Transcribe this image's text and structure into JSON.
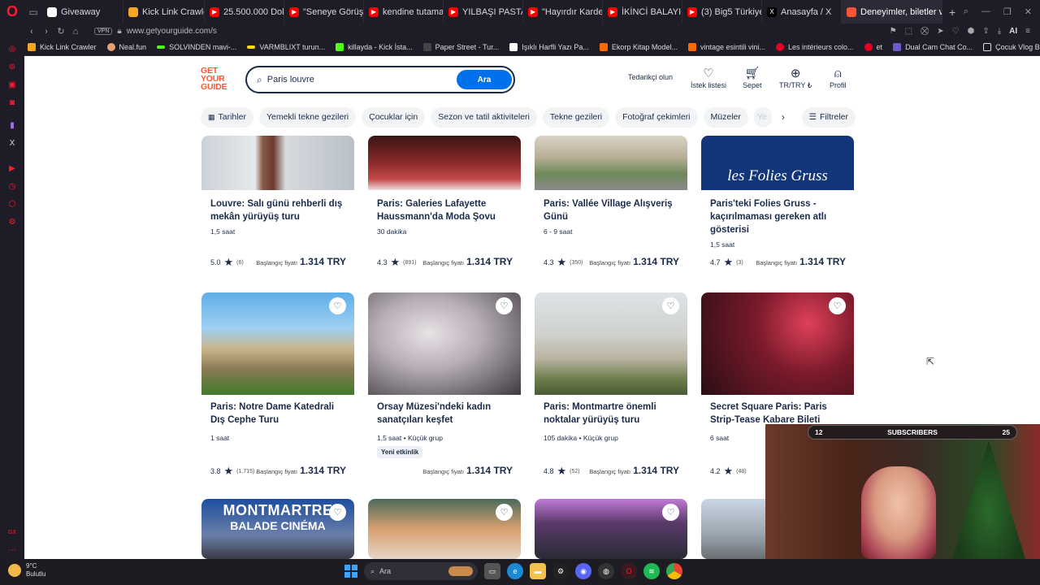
{
  "browser": {
    "tabs": [
      {
        "label": "Giveaway",
        "color": "#ffffff"
      },
      {
        "label": "Kick Link Crawler",
        "color": "#f5a623"
      },
      {
        "label": "25.500.000 Dolar",
        "color": "#ff0000"
      },
      {
        "label": "\"Seneye Görüşür",
        "color": "#ff0000"
      },
      {
        "label": "kendine tutamaya",
        "color": "#ff0000"
      },
      {
        "label": "YILBAŞI PASTASI",
        "color": "#ff0000"
      },
      {
        "label": "\"Hayırdır Kardeş",
        "color": "#ff0000"
      },
      {
        "label": "İKİNCİ BALAYIMIZ",
        "color": "#ff0000"
      },
      {
        "label": "(3) Big5 Türkiye |",
        "color": "#ff0000"
      },
      {
        "label": "Anasayfa / X",
        "color": "#ffffff"
      },
      {
        "label": "Deneyimler, biletler ve turl",
        "color": "#ff5533"
      }
    ],
    "active_tab_index": 10,
    "vpn_label": "VPN",
    "url": "www.getyourguide.com/s",
    "ai_label": "AI",
    "bookmarks": [
      {
        "label": "Kick Link Crawler",
        "color": "#f5a623"
      },
      {
        "label": "Neal.fun",
        "color": "#e8a070"
      },
      {
        "label": "SOLVINDEN mavi-...",
        "color": "#53fc18"
      },
      {
        "label": "VARMBLIXT turun...",
        "color": "#ffdb00"
      },
      {
        "label": "killayda - Kick İsta...",
        "color": "#53fc18"
      },
      {
        "label": "Paper Street - Tur...",
        "color": "#444444"
      },
      {
        "label": "Işıklı Harfli Yazı Pa...",
        "color": "#ffffff"
      },
      {
        "label": "Ekorp Kitap Model...",
        "color": "#ff6a00"
      },
      {
        "label": "vintage esintili vini...",
        "color": "#ff6a00"
      },
      {
        "label": "Les intérieurs colo...",
        "color": "#e60023"
      },
      {
        "label": "et",
        "color": "#e60023"
      },
      {
        "label": "Dual Cam Chat Co...",
        "color": "#6a5acd"
      },
      {
        "label": "Çocuk Vlog Bingosu",
        "color": "#dddddd"
      }
    ]
  },
  "site": {
    "logo": [
      "GET",
      "YOUR",
      "GUIDE"
    ],
    "search_value": "Paris louvre",
    "search_button": "Ara",
    "supplier_link": "Tedarikçi olun",
    "wishlist": "İstek listesi",
    "cart": "Sepet",
    "locale": "TR/TRY ₺",
    "profile": "Profil",
    "filters": [
      "Tarihler",
      "Yemekli tekne gezileri",
      "Çocuklar için",
      "Sezon ve tatil aktiviteleri",
      "Tekne gezileri",
      "Fotoğraf çekimleri",
      "Müzeler",
      "Ye"
    ],
    "filters_button": "Filtreler",
    "price_prefix": "Başlangıç fiyatı"
  },
  "cards_row1": [
    {
      "title": "Louvre: Salı günü rehberli dış mekân yürüyüş turu",
      "duration": "1,5 saat",
      "rating": "5.0",
      "count": "(6)",
      "price": "1.314 TRY"
    },
    {
      "title": "Paris: Galeries Lafayette Haussmann'da Moda Şovu",
      "duration": "30 dakika",
      "rating": "4.3",
      "count": "(891)",
      "price": "1.314 TRY"
    },
    {
      "title": "Paris: Vallée Village Alışveriş Günü",
      "duration": "6 - 9 saat",
      "rating": "4.3",
      "count": "(350)",
      "price": "1.314 TRY"
    },
    {
      "title": "Paris'teki Folies Gruss - kaçırılmaması gereken atlı gösterisi",
      "duration": "1,5 saat",
      "rating": "4.7",
      "count": "(3)",
      "price": "1.314 TRY",
      "image_text": "les Folies Gruss"
    }
  ],
  "cards_row2": [
    {
      "title": "Paris: Notre Dame Katedrali Dış Cephe Turu",
      "duration": "1 saat",
      "rating": "3.8",
      "count": "(1.715)",
      "price": "1.314 TRY"
    },
    {
      "title": "Orsay Müzesi'ndeki kadın sanatçıları keşfet",
      "duration": "1,5 saat • Küçük grup",
      "badge": "Yeni etkinlik",
      "price": "1.314 TRY"
    },
    {
      "title": "Paris: Montmartre önemli noktalar yürüyüş turu",
      "duration": "105 dakika • Küçük grup",
      "rating": "4.8",
      "count": "(52)",
      "price": "1.314 TRY"
    },
    {
      "title": "Secret Square Paris: Paris Strip-Tease Kabare Bileti",
      "duration": "6 saat",
      "rating": "4.2",
      "count": "(48)",
      "price": "Ba"
    }
  ],
  "cards_row3": [
    {
      "image_text_1": "MONTMARTRE",
      "image_text_2": "BALADE CINÉMA"
    }
  ],
  "stream": {
    "subs_left": "12",
    "subs_label": "SUBSCRIBERS",
    "subs_right": "25"
  },
  "taskbar": {
    "temp": "9°C",
    "condition": "Bulutlu",
    "search": "Ara"
  }
}
